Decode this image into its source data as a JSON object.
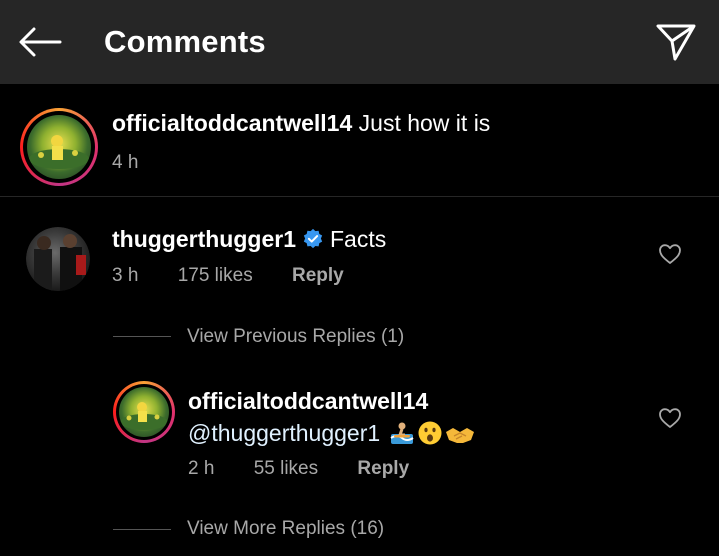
{
  "header": {
    "title": "Comments"
  },
  "caption": {
    "username": "officialtoddcantwell14",
    "text": "Just how it is",
    "time": "4 h"
  },
  "comment": {
    "username": "thuggerthugger1",
    "verified": true,
    "text": "Facts",
    "time": "3 h",
    "likes": "175 likes",
    "reply_label": "Reply"
  },
  "replies": {
    "view_previous": "View Previous Replies (1)",
    "items": [
      {
        "username": "officialtoddcantwell14",
        "mention": "@thuggerthugger1",
        "emojis": [
          "surfer-emoji",
          "astonished-face-emoji",
          "handshake-emoji"
        ],
        "time": "2 h",
        "likes": "55 likes",
        "reply_label": "Reply"
      }
    ],
    "view_more": "View More Replies (16)"
  },
  "colors": {
    "header_bg": "#262626",
    "background": "#000000",
    "secondary_text": "#a8a8a8",
    "verified_blue": "#3897f0"
  }
}
